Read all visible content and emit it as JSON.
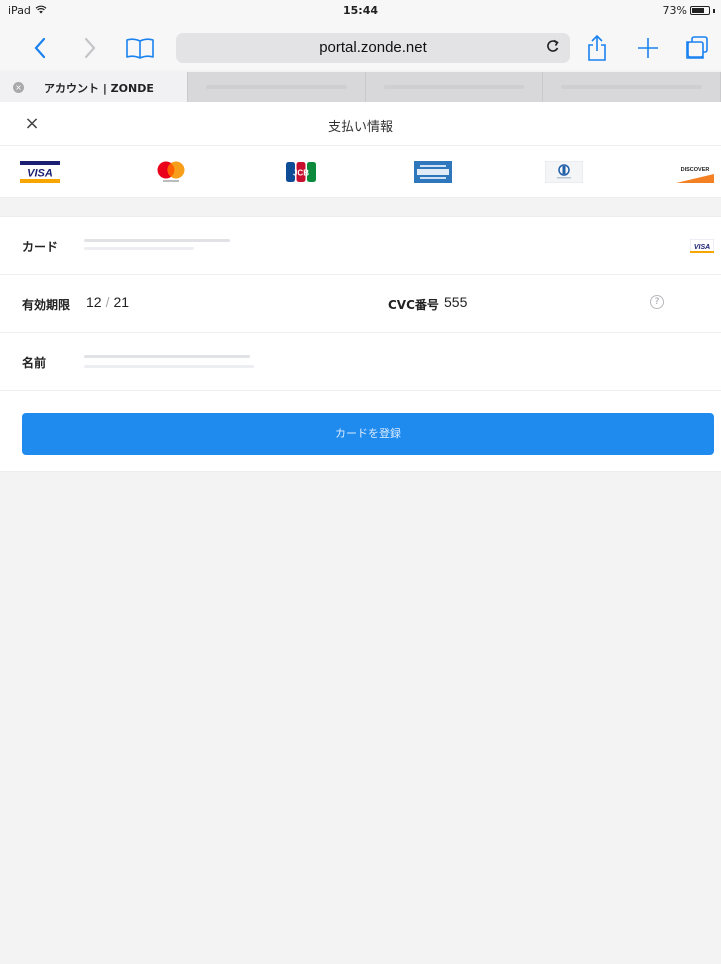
{
  "status_bar": {
    "device": "iPad",
    "time": "15:44",
    "battery_text": "73%",
    "battery_level": 0.73
  },
  "toolbar": {
    "url": "portal.zonde.net",
    "reload_icon": "reload-icon",
    "icons": [
      "back-icon",
      "forward-icon",
      "bookmarks-icon",
      "share-icon",
      "new-tab-icon",
      "tabs-icon"
    ]
  },
  "tabs": {
    "active_title": "アカウント | ZONDE"
  },
  "modal": {
    "close_icon": "×",
    "title": "支払い情報",
    "brands": [
      "VISA",
      "Mastercard",
      "JCB",
      "American Express",
      "Diners Club",
      "DISCOVER"
    ],
    "card_label": "カード",
    "card_brand_badge": "VISA",
    "expiry_label": "有効期限",
    "expiry_month": "12",
    "expiry_sep": "/",
    "expiry_year": "21",
    "cvc_label": "CVC番号",
    "cvc_value": "555",
    "help_icon": "?",
    "name_label": "名前",
    "submit_label": "カードを登録"
  },
  "colors": {
    "accent": "#1f8bef",
    "safari_blue": "#1a82f0",
    "visa_blue": "#1a1f71",
    "visa_gold": "#f7a600"
  }
}
